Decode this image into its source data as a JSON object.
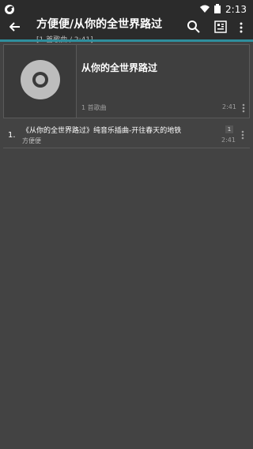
{
  "status_bar": {
    "time": "2:13",
    "app_icon": "app-logo-icon",
    "wifi_icon": "wifi-icon",
    "battery_icon": "battery-icon"
  },
  "toolbar": {
    "title": "方便便/从你的全世界路过",
    "subtitle": "[1 首歌曲 / 2:41]",
    "back_icon": "back-arrow-icon",
    "search_icon": "search-icon",
    "view_icon": "view-list-icon",
    "more_icon": "more-vert-icon"
  },
  "colors": {
    "accent": "#2f8f9e",
    "background": "#434343",
    "toolbar": "#2b2b2b"
  },
  "album": {
    "title": "从你的全世界路过",
    "count": "1 首歌曲",
    "duration": "2:41",
    "art_icon": "disc-icon",
    "more_icon": "more-vert-icon"
  },
  "tracks": [
    {
      "number": "1.",
      "title": "《从你的全世界路过》纯音乐插曲-开往春天的地铁",
      "artist": "方便便",
      "badge": "1",
      "duration": "2:41"
    }
  ]
}
